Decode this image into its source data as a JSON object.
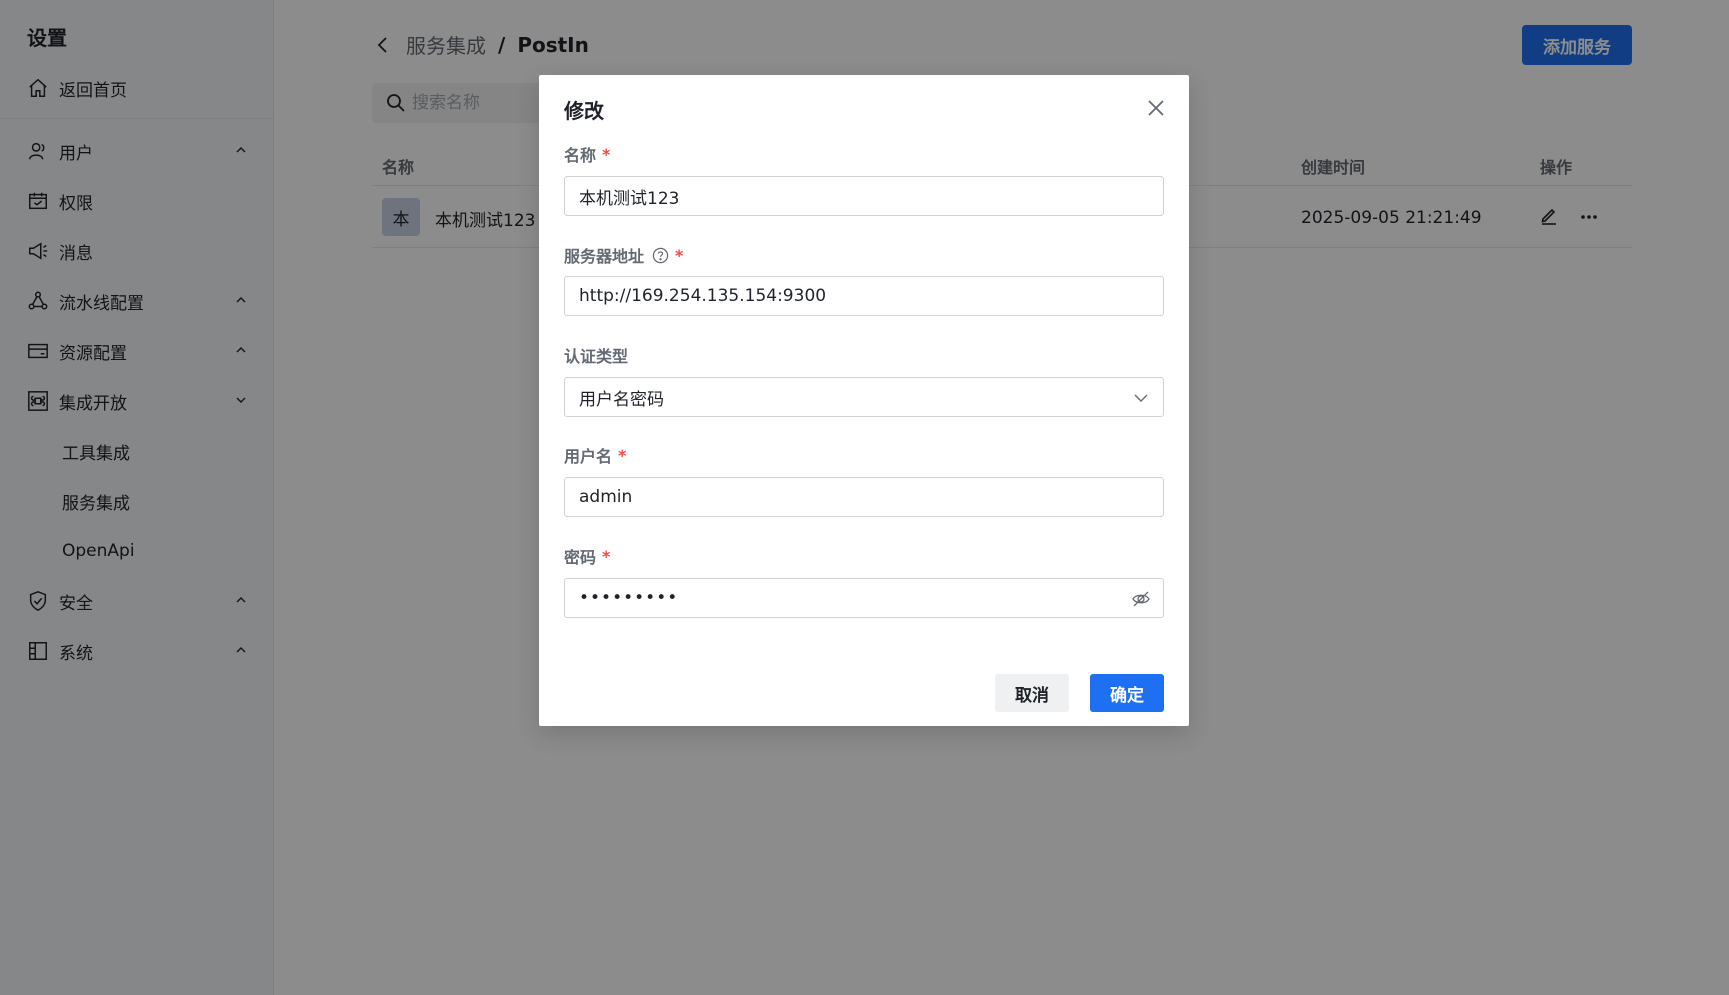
{
  "sidebar": {
    "title": "设置",
    "home": "返回首页",
    "items": [
      {
        "label": "用户",
        "icon": "user-icon"
      },
      {
        "label": "权限",
        "icon": "calendar-icon"
      },
      {
        "label": "消息",
        "icon": "megaphone-icon"
      },
      {
        "label": "流水线配置",
        "icon": "pipeline-icon"
      },
      {
        "label": "资源配置",
        "icon": "card-icon"
      },
      {
        "label": "集成开放",
        "icon": "command-icon"
      },
      {
        "label": "安全",
        "icon": "shield-icon"
      },
      {
        "label": "系统",
        "icon": "layout-icon"
      }
    ],
    "sub_items": [
      "工具集成",
      "服务集成",
      "OpenApi"
    ]
  },
  "header": {
    "breadcrumb_parent": "服务集成",
    "breadcrumb_separator": "/",
    "breadcrumb_current": "PostIn",
    "add_button": "添加服务"
  },
  "search": {
    "placeholder": "搜索名称"
  },
  "table": {
    "columns": {
      "name": "名称",
      "created": "创建时间",
      "actions": "操作"
    },
    "rows": [
      {
        "avatar": "本",
        "name": "本机测试123",
        "created": "2025-09-05 21:21:49"
      }
    ]
  },
  "modal": {
    "title": "修改",
    "name_label": "名称",
    "name_value": "本机测试123",
    "server_label": "服务器地址",
    "server_value": "http://169.254.135.154:9300",
    "auth_label": "认证类型",
    "auth_value": "用户名密码",
    "username_label": "用户名",
    "username_value": "admin",
    "password_label": "密码",
    "password_value": "•••••••••",
    "required_mark": "*",
    "cancel": "取消",
    "ok": "确定"
  },
  "colors": {
    "primary": "#1e6ff1",
    "required": "#f54a45"
  }
}
